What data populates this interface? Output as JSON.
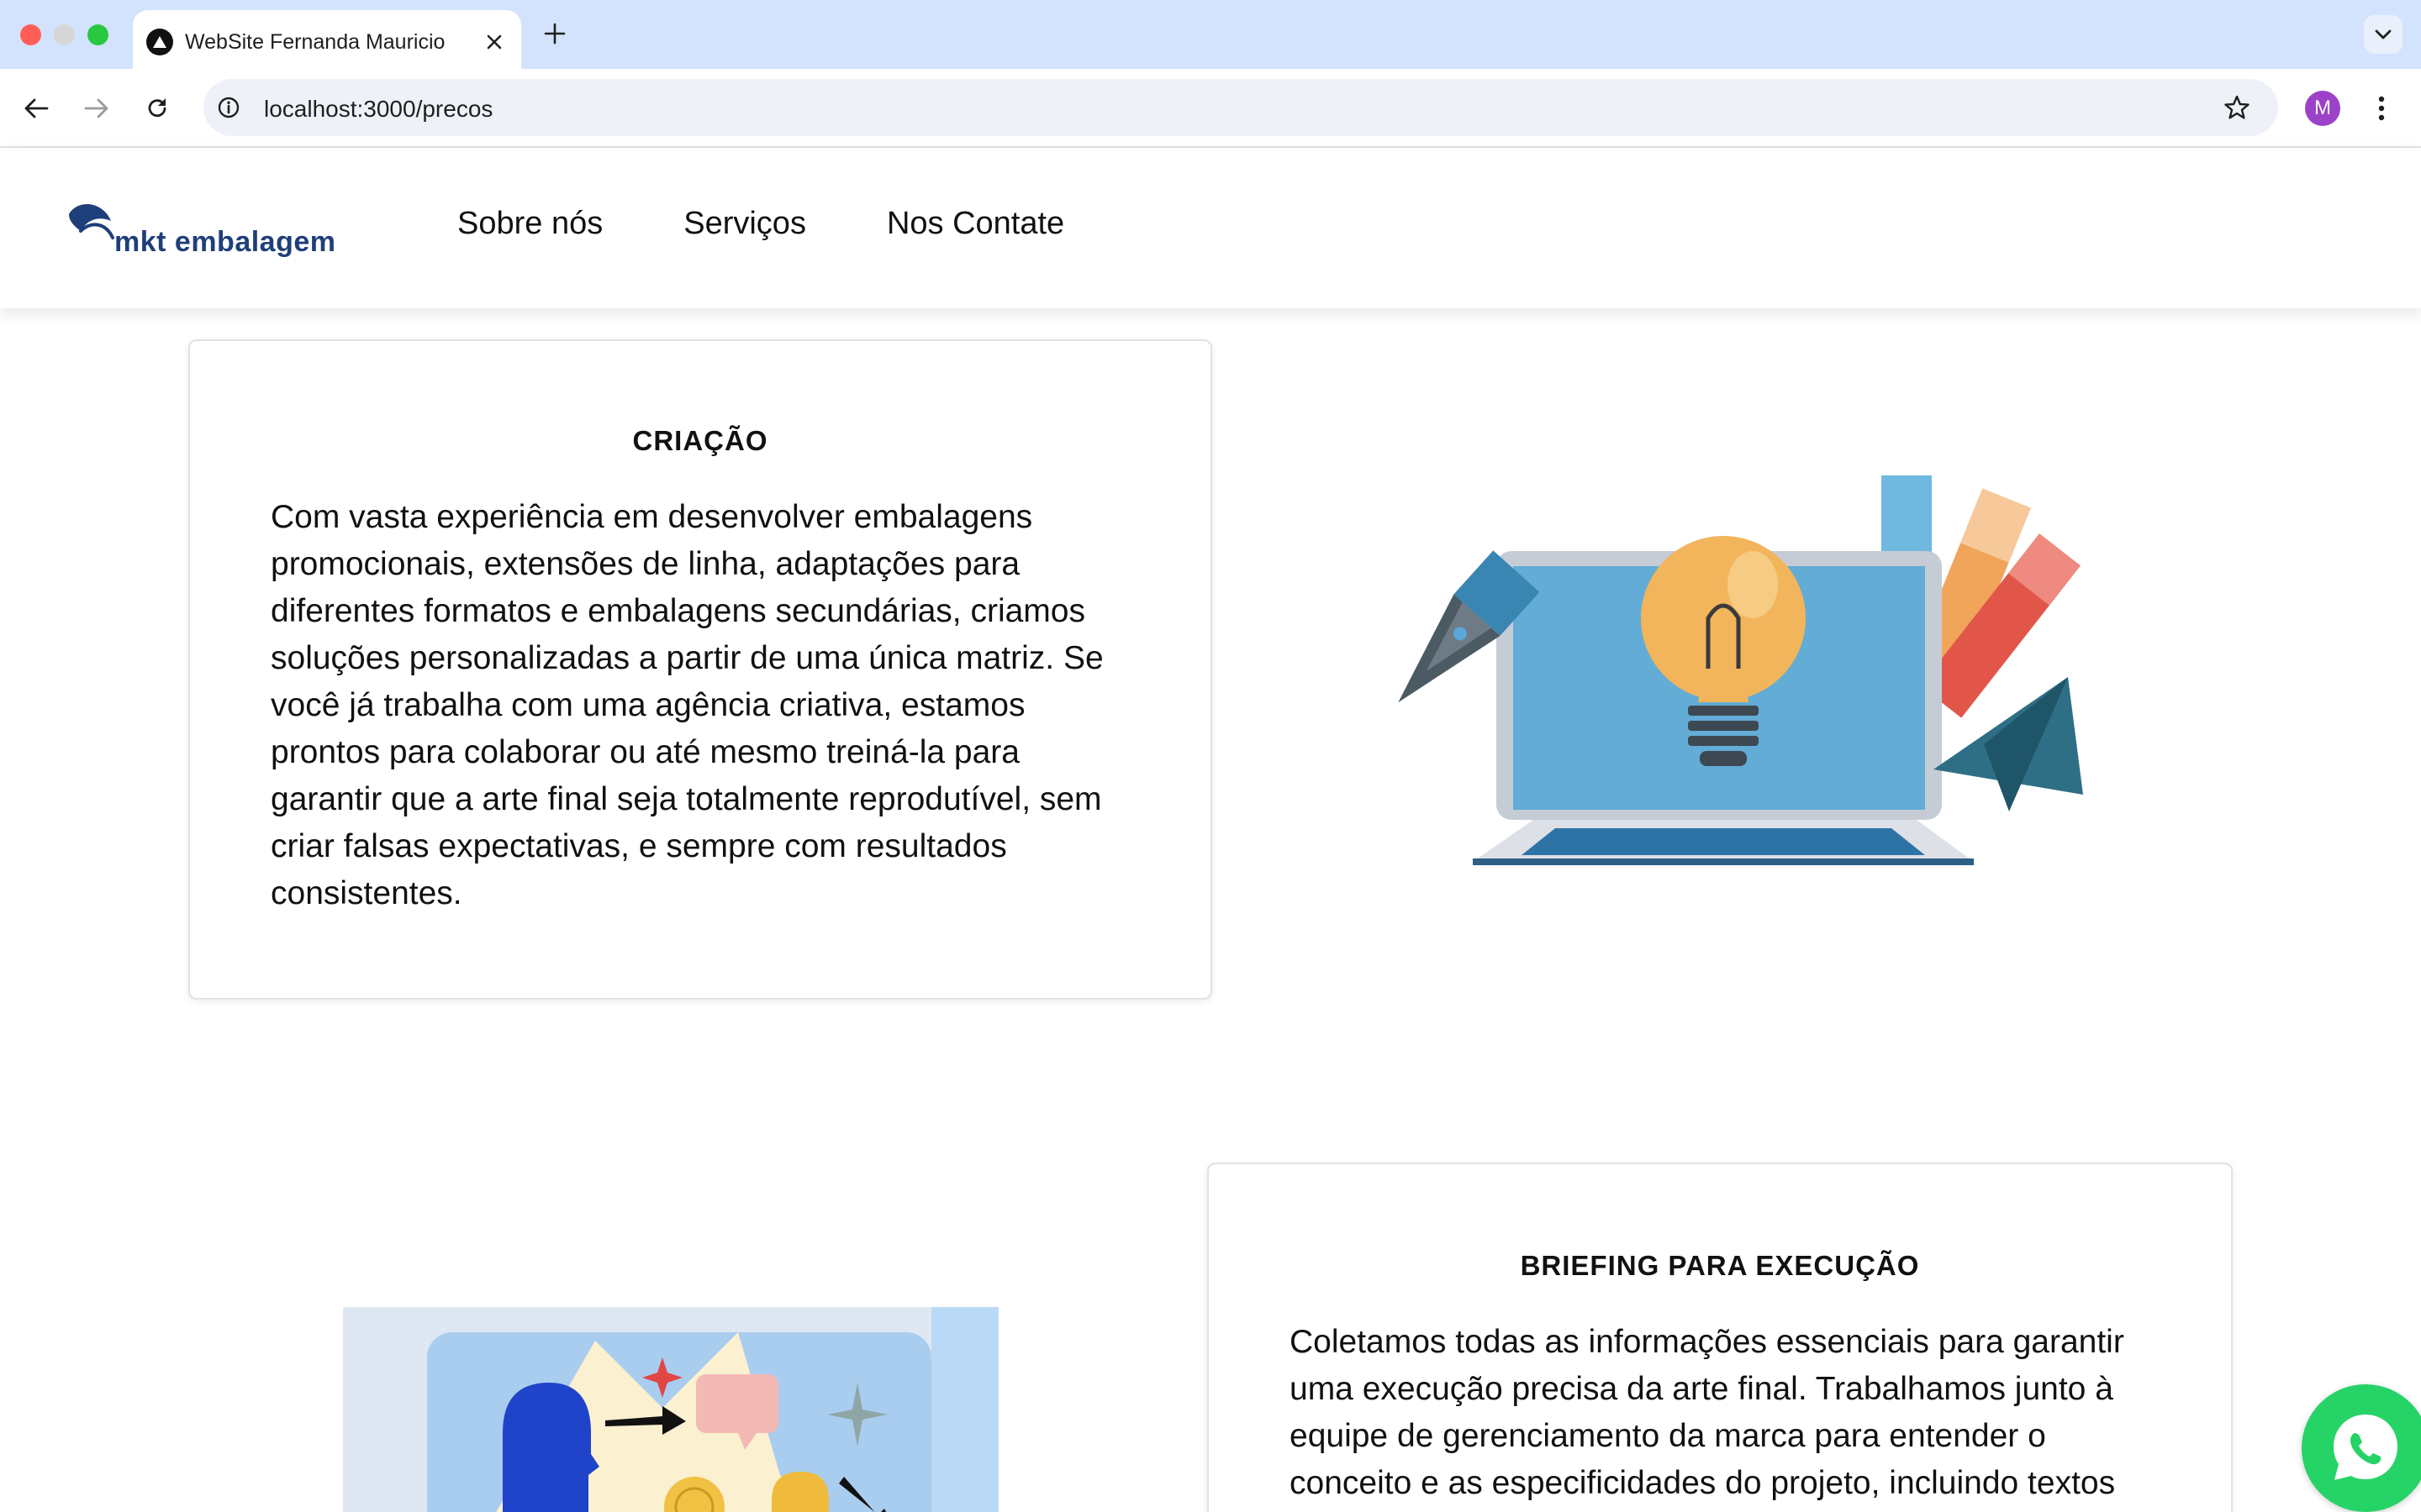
{
  "browser": {
    "tab_title": "WebSite Fernanda Mauricio",
    "url": "localhost:3000/precos",
    "avatar_letter": "M"
  },
  "site": {
    "logo_text": "mkt embalagem",
    "nav": [
      "Sobre nós",
      "Serviços",
      "Nos Contate"
    ]
  },
  "sections": [
    {
      "title": "CRIAÇÃO",
      "text": "Com vasta experiência em desenvolver embalagens promocionais, extensões de linha, adaptações para diferentes formatos e embalagens secundárias, criamos soluções personalizadas a partir de uma única matriz. Se você já trabalha com uma agência criativa, estamos prontos para colaborar ou até mesmo treiná-la para garantir que a arte final seja totalmente reprodutível, sem criar falsas expectativas, e sempre com resultados consistentes."
    },
    {
      "title": "BRIEFING PARA EXECUÇÃO",
      "text": "Coletamos todas as informações essenciais para garantir uma execução precisa da arte final. Trabalhamos junto à equipe de gerenciamento da marca para entender o conceito e as especificidades do projeto, incluindo textos"
    }
  ],
  "colors": {
    "brand_blue": "#1f3f7a",
    "whatsapp_green": "#25d366",
    "tabbar": "#d3e3fd"
  }
}
